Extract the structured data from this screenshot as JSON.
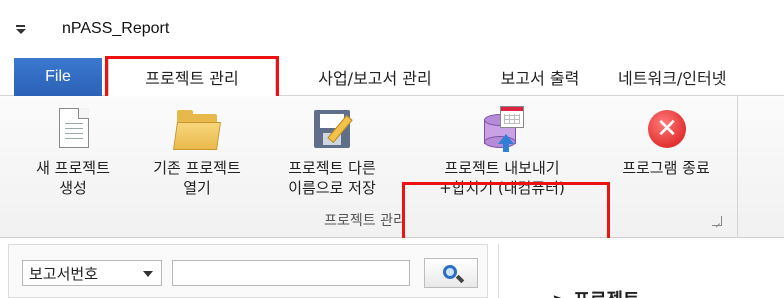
{
  "window": {
    "title": "nPASS_Report"
  },
  "tabs": {
    "file": "File",
    "items": [
      "프로젝트 관리",
      "사업/보고서 관리",
      "보고서 출력",
      "네트워크/인터넷"
    ]
  },
  "ribbon": {
    "group_label": "프로젝트 관리",
    "buttons": {
      "new_project": {
        "line1": "새 프로젝트",
        "line2": "생성",
        "icon": "new-document-icon"
      },
      "open_project": {
        "line1": "기존 프로젝트",
        "line2": "열기",
        "icon": "folder-icon"
      },
      "save_as": {
        "line1": "프로젝트 다른",
        "line2": "이름으로 저장",
        "icon": "floppy-save-icon"
      },
      "export_merge": {
        "line1": "프로젝트 내보내기",
        "line2": "+합치기 (내컴퓨터)",
        "icon": "database-export-icon"
      },
      "exit": {
        "line1": "프로그램 종료",
        "icon": "close-circle-icon",
        "glyph": "✕"
      }
    }
  },
  "search": {
    "field_select": "보고서번호",
    "query": ""
  },
  "right_panel": {
    "title": "> 프로젝트"
  },
  "colors": {
    "file_tab": "#2b62b6",
    "highlight": "#ee1111",
    "exit": "#e23131"
  }
}
